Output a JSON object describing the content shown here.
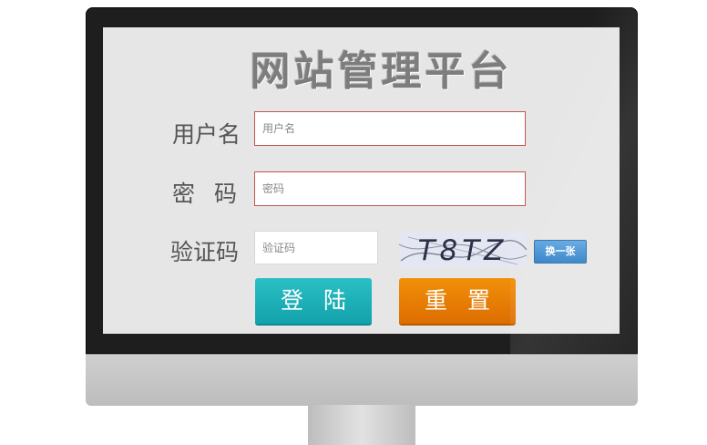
{
  "page": {
    "title": "网站管理平台"
  },
  "form": {
    "username_label": "用户名",
    "username_placeholder": "用户名",
    "password_label": "密码",
    "password_placeholder": "密码",
    "captcha_label": "验证码",
    "captcha_placeholder": "验证码",
    "captcha_text": "T8TZ",
    "refresh_captcha_label": "换一张",
    "login_button": "登陆",
    "reset_button": "重置"
  },
  "colors": {
    "input_border": "#c2574a",
    "login_button": "#17aeb6",
    "reset_button": "#ea7d05",
    "refresh_button": "#3f8fd4",
    "screen_background": "#e6e6e6"
  }
}
